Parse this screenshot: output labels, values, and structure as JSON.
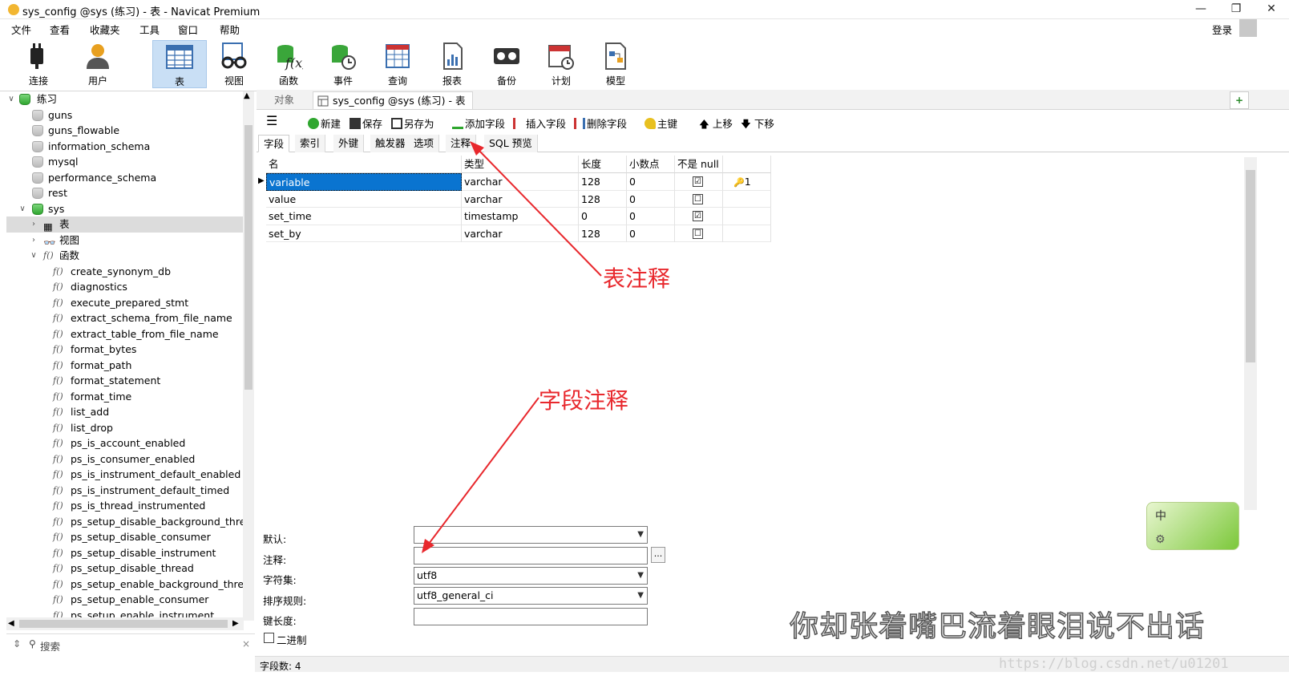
{
  "window": {
    "title": "sys_config @sys (练习) - 表 - Navicat Premium",
    "minimize": "—",
    "restore": "❐",
    "close": "✕"
  },
  "menu": [
    "文件",
    "查看",
    "收藏夹",
    "工具",
    "窗口",
    "帮助"
  ],
  "login": "登录",
  "toolbar": [
    "连接",
    "用户",
    "表",
    "视图",
    "函数",
    "事件",
    "查询",
    "报表",
    "备份",
    "计划",
    "模型"
  ],
  "tree": {
    "root": "练习",
    "databases": [
      "guns",
      "guns_flowable",
      "information_schema",
      "mysql",
      "performance_schema",
      "rest",
      "sys"
    ],
    "sys_children": [
      "表",
      "视图",
      "函数"
    ],
    "functions": [
      "create_synonym_db",
      "diagnostics",
      "execute_prepared_stmt",
      "extract_schema_from_file_name",
      "extract_table_from_file_name",
      "format_bytes",
      "format_path",
      "format_statement",
      "format_time",
      "list_add",
      "list_drop",
      "ps_is_account_enabled",
      "ps_is_consumer_enabled",
      "ps_is_instrument_default_enabled",
      "ps_is_instrument_default_timed",
      "ps_is_thread_instrumented",
      "ps_setup_disable_background_threads",
      "ps_setup_disable_consumer",
      "ps_setup_disable_instrument",
      "ps_setup_disable_thread",
      "ps_setup_enable_background_threads",
      "ps_setup_enable_consumer",
      "ps_setup_enable_instrument"
    ],
    "search": "搜索"
  },
  "objtabs": [
    "对象",
    "sys_config @sys (练习) - 表"
  ],
  "subtoolbar": [
    "新建",
    "保存",
    "另存为",
    "添加字段",
    "插入字段",
    "删除字段",
    "主键",
    "上移",
    "下移"
  ],
  "edtabs": [
    "字段",
    "索引",
    "外键",
    "触发器",
    "选项",
    "注释",
    "SQL 预览"
  ],
  "grid": {
    "headers": [
      "名",
      "类型",
      "长度",
      "小数点",
      "不是 null",
      ""
    ],
    "rows": [
      {
        "name": "variable",
        "type": "varchar",
        "len": "128",
        "dec": "0",
        "notnull": "☑",
        "key": "1"
      },
      {
        "name": "value",
        "type": "varchar",
        "len": "128",
        "dec": "0",
        "notnull": "☐",
        "key": ""
      },
      {
        "name": "set_time",
        "type": "timestamp",
        "len": "0",
        "dec": "0",
        "notnull": "☑",
        "key": ""
      },
      {
        "name": "set_by",
        "type": "varchar",
        "len": "128",
        "dec": "0",
        "notnull": "☐",
        "key": ""
      }
    ]
  },
  "props": {
    "default_label": "默认:",
    "comment_label": "注释:",
    "charset_label": "字符集:",
    "charset": "utf8",
    "collation_label": "排序规则:",
    "collation": "utf8_general_ci",
    "keylen_label": "键长度:",
    "binary_label": "二进制",
    "ellipsis": "..."
  },
  "status": "字段数: 4",
  "annotations": {
    "table_comment": "表注释",
    "field_comment": "字段注释"
  },
  "caption": "你却张着嘴巴流着眼泪说不出话",
  "watermark": "https://blog.csdn.net/u01201",
  "ime": "中",
  "colors": {
    "selection": "#0a74d0",
    "annotation": "#e8282d",
    "active_tool": "#c9dff5"
  }
}
